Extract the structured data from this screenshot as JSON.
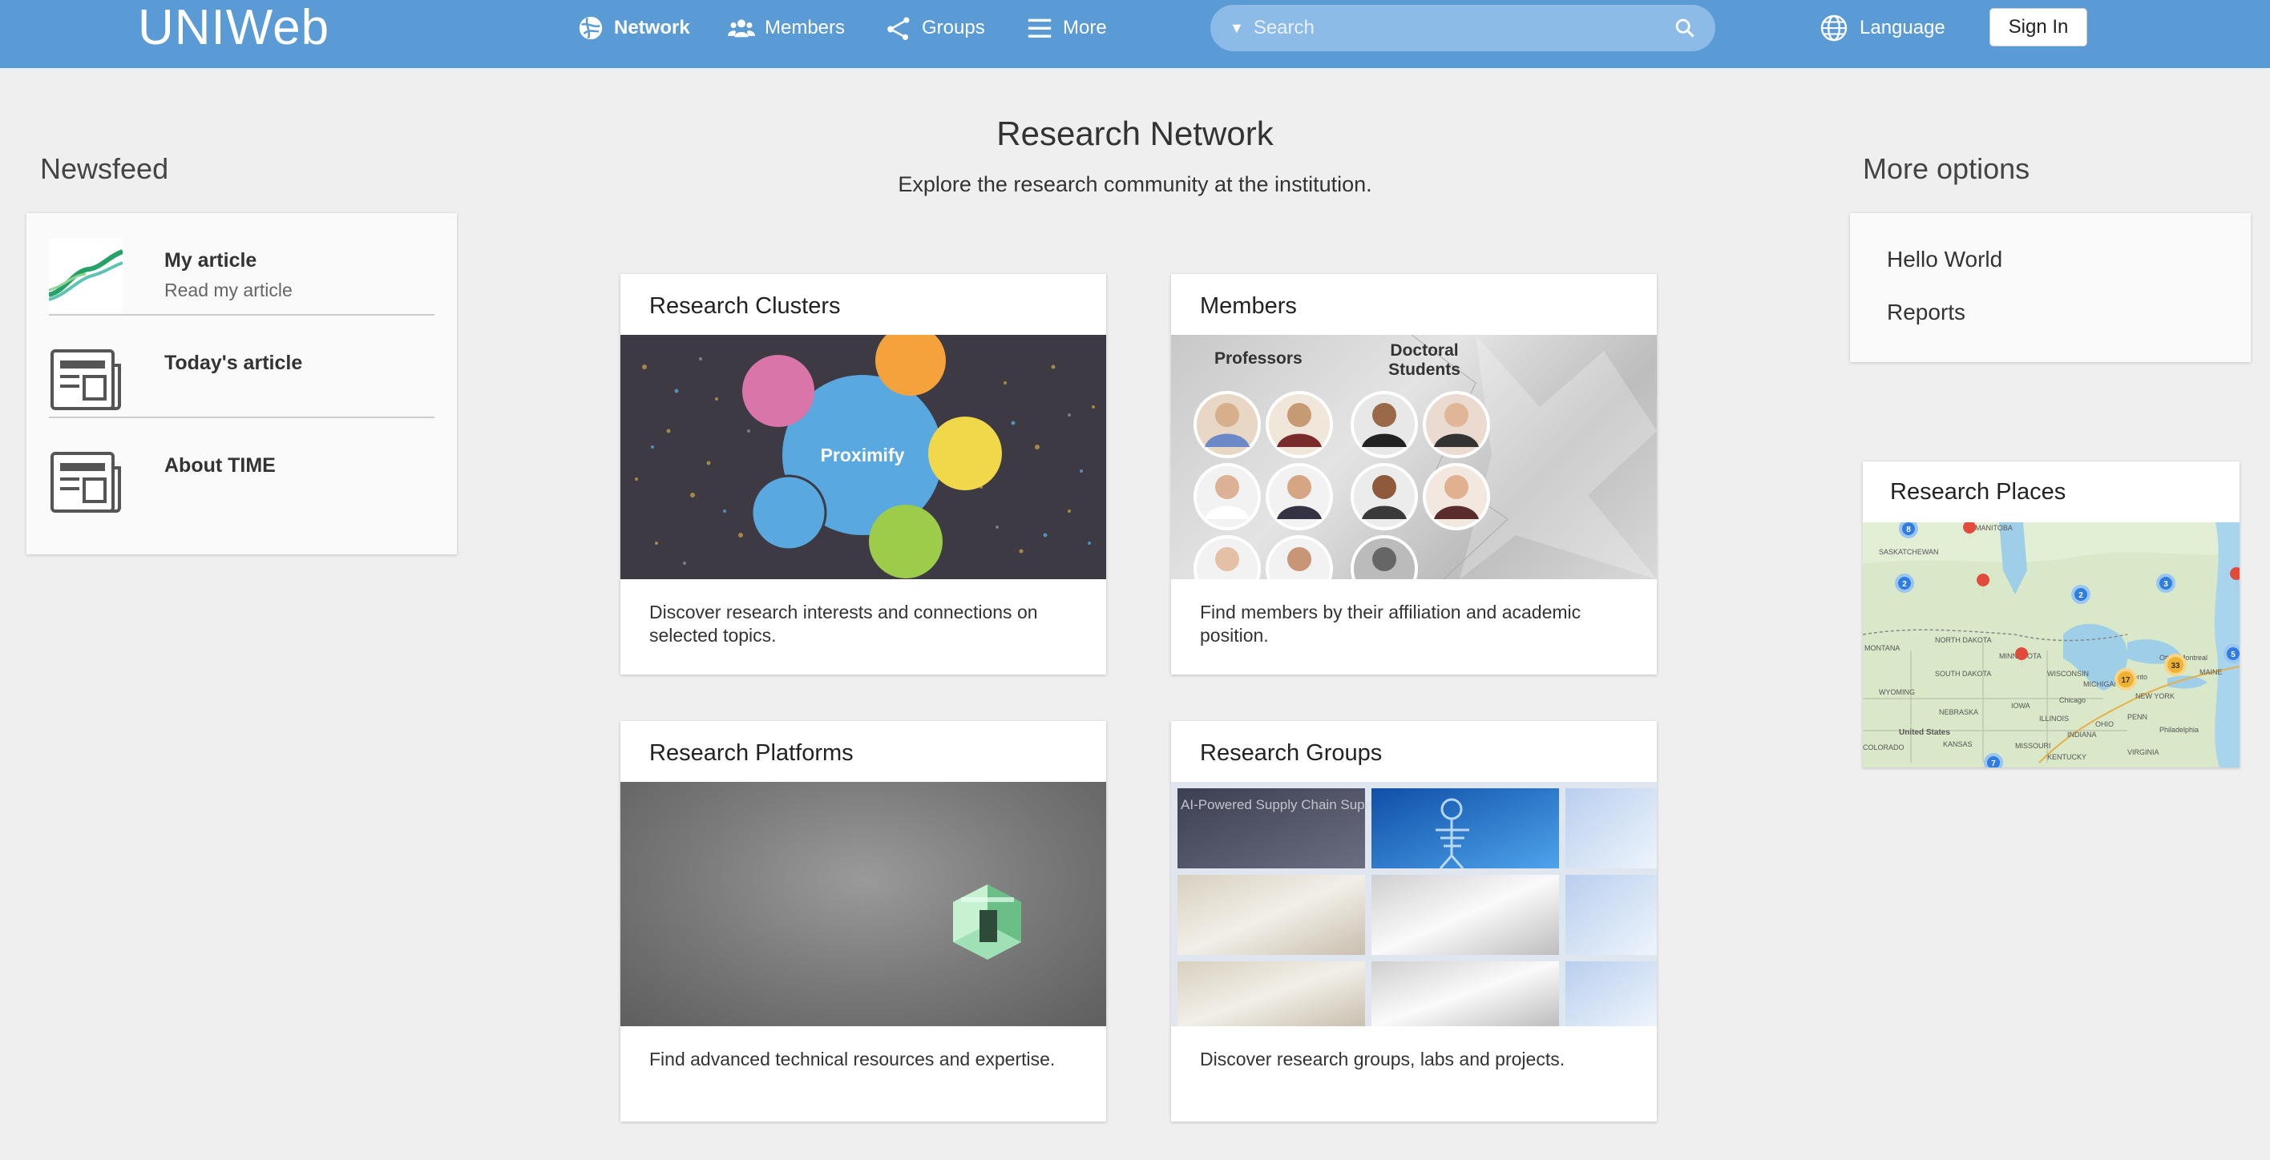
{
  "header": {
    "logo": "UNIWeb",
    "nav": [
      {
        "label": "Network",
        "icon": "globe-network-icon"
      },
      {
        "label": "Members",
        "icon": "members-icon"
      },
      {
        "label": "Groups",
        "icon": "groups-share-icon"
      },
      {
        "label": "More",
        "icon": "hamburger-menu-icon"
      }
    ],
    "search_placeholder": "Search",
    "language": "Language",
    "signin": "Sign In"
  },
  "page": {
    "title": "Research Network",
    "subtitle": "Explore the research community at the institution."
  },
  "newsfeed": {
    "heading": "Newsfeed",
    "items": [
      {
        "title": "My article",
        "subtitle": "Read my article"
      },
      {
        "title": "Today's article",
        "subtitle": ""
      },
      {
        "title": "About TIME",
        "subtitle": ""
      }
    ]
  },
  "more_options": {
    "heading": "More options",
    "items": [
      "Hello World",
      "Reports"
    ]
  },
  "cards": [
    {
      "title": "Research Clusters",
      "desc": "Discover research interests and connections on selected topics.",
      "image_label": "Proximify"
    },
    {
      "title": "Members",
      "desc": "Find members by their affiliation and academic position.",
      "col1": "Professors",
      "col2": "Doctoral Students"
    },
    {
      "title": "Research Platforms",
      "desc": "Find advanced technical resources and expertise."
    },
    {
      "title": "Research Groups",
      "desc": "Discover research groups, labs and projects.",
      "tile_text": "AI-Powered Supply Chain Supercluster"
    }
  ],
  "places": {
    "title": "Research Places",
    "labels": [
      "SASKATCHEWAN",
      "MANITOBA",
      "NORTH DAKOTA",
      "MONTANA",
      "SOUTH DAKOTA",
      "WYOMING",
      "NEBRASKA",
      "MINNESOTA",
      "WISCONSIN",
      "IOWA",
      "ILLINOIS",
      "INDIANA",
      "MICHIGAN",
      "Chicago",
      "Toronto",
      "Ottawa",
      "NEW YORK",
      "PENN",
      "Philadelphia",
      "United States",
      "KANSAS",
      "MISSOURI",
      "KENTUCKY",
      "VIRGINIA",
      "COLORADO",
      "MAINE",
      "Montreal",
      "OHIO"
    ],
    "clusters": [
      "8",
      "2",
      "3",
      "5",
      "2",
      "33",
      "17",
      "7"
    ]
  },
  "colors": {
    "topbar": "#5b9bd5",
    "background": "#efefef"
  }
}
